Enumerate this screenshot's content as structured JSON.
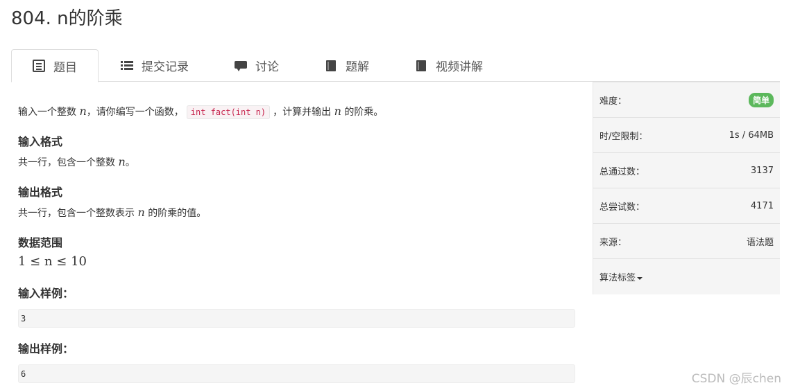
{
  "title": "804. n的阶乘",
  "tabs": [
    {
      "label": "题目",
      "icon": "list-alt-icon",
      "active": true
    },
    {
      "label": "提交记录",
      "icon": "list-icon",
      "active": false
    },
    {
      "label": "讨论",
      "icon": "comment-icon",
      "active": false
    },
    {
      "label": "题解",
      "icon": "book-icon",
      "active": false
    },
    {
      "label": "视频讲解",
      "icon": "book-icon",
      "active": false
    }
  ],
  "problem": {
    "desc_prefix": "输入一个整数",
    "var_n": "n",
    "desc_mid": "，请你编写一个函数，",
    "code": "int fact(int n)",
    "desc_mid2": "，计算并输出",
    "desc_suffix": "的阶乘。",
    "input_heading": "输入格式",
    "input_text_prefix": "共一行，包含一个整数",
    "input_text_suffix": "。",
    "output_heading": "输出格式",
    "output_text_prefix": "共一行，包含一个整数表示",
    "output_text_suffix": "的阶乘的值。",
    "range_heading": "数据范围",
    "range_text": "1 ≤ n ≤ 10",
    "sample_input_heading": "输入样例：",
    "sample_input": "3",
    "sample_output_heading": "输出样例：",
    "sample_output": "6"
  },
  "sidebar": {
    "difficulty_label": "难度：",
    "difficulty_value": "简单",
    "difficulty_color": "#5cb85c",
    "limit_label": "时/空限制：",
    "limit_value": "1s / 64MB",
    "passed_label": "总通过数：",
    "passed_value": "3137",
    "attempts_label": "总尝试数：",
    "attempts_value": "4171",
    "source_label": "来源：",
    "source_value": "语法题",
    "tags_label": "算法标签"
  },
  "watermark": "CSDN @辰chen"
}
